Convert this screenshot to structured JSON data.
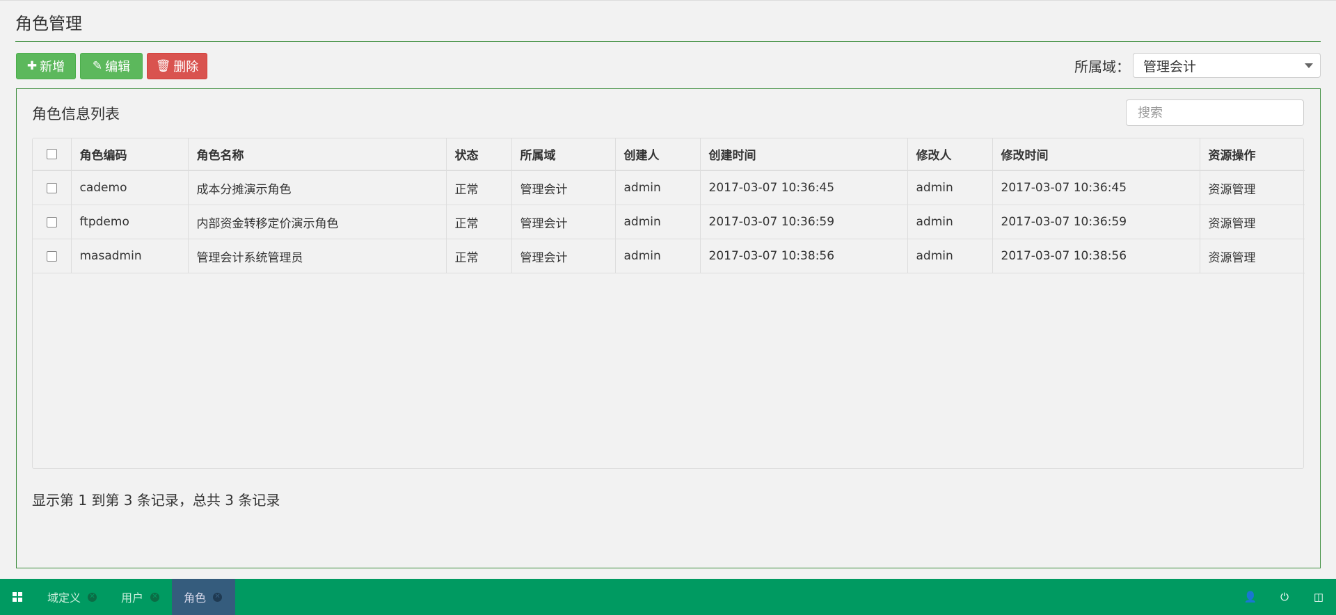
{
  "page": {
    "title": "角色管理"
  },
  "toolbar": {
    "add_label": "新增",
    "edit_label": "编辑",
    "delete_label": "删除",
    "domain_label": "所属域：",
    "domain_value": "管理会计"
  },
  "panel": {
    "title": "角色信息列表",
    "search_placeholder": "搜索"
  },
  "table": {
    "headers": [
      "角色编码",
      "角色名称",
      "状态",
      "所属域",
      "创建人",
      "创建时间",
      "修改人",
      "修改时间",
      "资源操作"
    ],
    "rows": [
      [
        "cademo",
        "成本分摊演示角色",
        "正常",
        "管理会计",
        "admin",
        "2017-03-07 10:36:45",
        "admin",
        "2017-03-07 10:36:45",
        "资源管理"
      ],
      [
        "ftpdemo",
        "内部资金转移定价演示角色",
        "正常",
        "管理会计",
        "admin",
        "2017-03-07 10:36:59",
        "admin",
        "2017-03-07 10:36:59",
        "资源管理"
      ],
      [
        "masadmin",
        "管理会计系统管理员",
        "正常",
        "管理会计",
        "admin",
        "2017-03-07 10:38:56",
        "admin",
        "2017-03-07 10:38:56",
        "资源管理"
      ]
    ]
  },
  "pager": {
    "summary": "显示第 1 到第 3 条记录，总共 3 条记录"
  },
  "taskbar": {
    "tabs": [
      {
        "label": "域定义"
      },
      {
        "label": "用户"
      },
      {
        "label": "角色"
      }
    ],
    "icons": [
      "start-icon",
      "user-icon",
      "power-icon",
      "window-icon"
    ],
    "active_tab_color": "#355c7d",
    "bar_color": "#009a61"
  }
}
